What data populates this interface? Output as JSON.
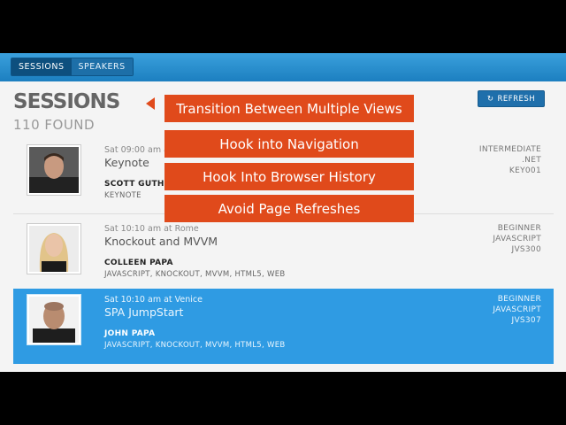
{
  "nav": {
    "tabs": [
      {
        "label": "SESSIONS",
        "active": true
      },
      {
        "label": "SPEAKERS",
        "active": false
      }
    ]
  },
  "header": {
    "title": "SESSIONS",
    "count": "110 FOUND",
    "refresh_label": "REFRESH"
  },
  "sessions": [
    {
      "meta": "Sat 09:00 am at",
      "title": "Keynote",
      "speaker": "SCOTT GUTHR",
      "tags": "KEYNOTE",
      "level": "INTERMEDIATE",
      "track": ".NET",
      "code": "KEY001"
    },
    {
      "meta": "Sat 10:10 am at Rome",
      "title": "Knockout and MVVM",
      "speaker": "COLLEEN PAPA",
      "tags": "JAVASCRIPT, KNOCKOUT, MVVM, HTML5, WEB",
      "level": "BEGINNER",
      "track": "JAVASCRIPT",
      "code": "JVS300"
    },
    {
      "meta": "Sat 10:10 am at Venice",
      "title": "SPA JumpStart",
      "speaker": "JOHN PAPA",
      "tags": "JAVASCRIPT, KNOCKOUT, MVVM, HTML5, WEB",
      "level": "BEGINNER",
      "track": "JAVASCRIPT",
      "code": "JVS307",
      "selected": true
    }
  ],
  "overlay": [
    "Transition Between Multiple Views",
    "Hook into Navigation",
    "Hook Into Browser History",
    "Avoid Page Refreshes"
  ],
  "colors": {
    "accent": "#e04a1b",
    "nav": "#1c7fc0",
    "selected_row": "#2f9be3"
  }
}
